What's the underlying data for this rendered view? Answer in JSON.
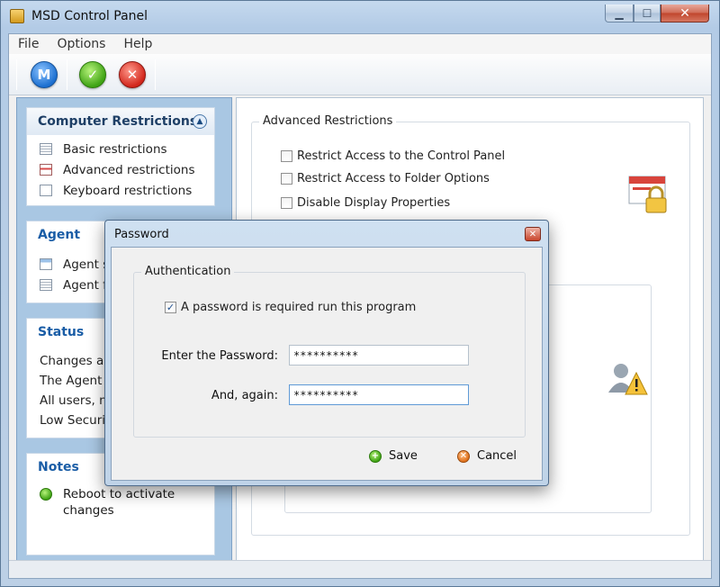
{
  "window": {
    "title": "MSD Control Panel"
  },
  "menu": [
    "File",
    "Options",
    "Help"
  ],
  "toolbar": {
    "buttons": [
      {
        "name": "m",
        "label": "M"
      },
      {
        "name": "ok",
        "label": "✓"
      },
      {
        "name": "x",
        "label": "✕"
      }
    ]
  },
  "sidebar": {
    "computer_restrictions": {
      "title": "Computer Restrictions",
      "items": [
        "Basic restrictions",
        "Advanced restrictions",
        "Keyboard restrictions"
      ]
    },
    "agent": {
      "title": "Agent",
      "items": [
        "Agent se",
        "Agent fo"
      ]
    },
    "status": {
      "title": "Status",
      "lines": [
        "Changes are",
        "The Agent is",
        "All users, no",
        "Low Security"
      ]
    },
    "notes": {
      "title": "Notes",
      "item": "Reboot to activate changes"
    }
  },
  "content": {
    "group_title": "Advanced Restrictions",
    "options": [
      {
        "label": "Restrict Access to the Control Panel",
        "checked": false
      },
      {
        "label": "Restrict Access to Folder Options",
        "checked": false
      },
      {
        "label": "Disable Display Properties",
        "checked": false
      }
    ]
  },
  "dialog": {
    "title": "Password",
    "group_title": "Authentication",
    "require_label": "A password is required run this program",
    "require_checked": true,
    "enter_label": "Enter the Password:",
    "enter_value": "**********",
    "again_label": "And, again:",
    "again_value": "**********",
    "save_label": "Save",
    "cancel_label": "Cancel"
  }
}
